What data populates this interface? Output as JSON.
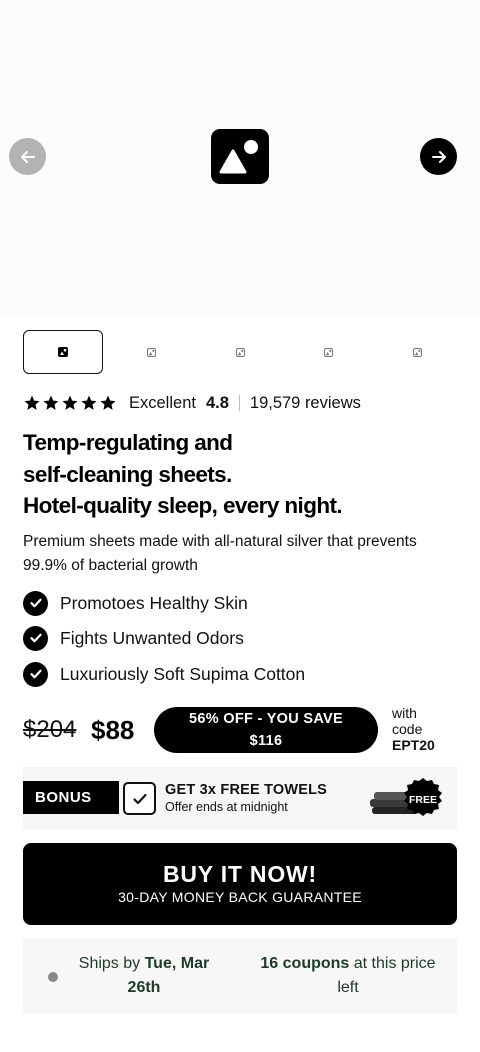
{
  "gallery": {
    "prev_icon": "arrow-left-icon",
    "next_icon": "arrow-right-icon",
    "main_image_icon": "image-placeholder-icon",
    "thumbnail_count": 5,
    "active_thumbnail": 1
  },
  "rating": {
    "stars": 5,
    "label": "Excellent",
    "score": "4.8",
    "reviews": "19,579 reviews"
  },
  "headline": {
    "line1": "Temp-regulating and",
    "line2": "self-cleaning sheets.",
    "line3": "Hotel-quality sleep, every night."
  },
  "subtext": "Premium sheets made with all-natural silver that prevents 99.9% of bacterial growth",
  "benefits": [
    "Promotoes Healthy Skin",
    "Fights Unwanted Odors",
    "Luxuriously Soft Supima Cotton"
  ],
  "pricing": {
    "old_price": "$204",
    "new_price": "$88",
    "save_line1": "56% OFF - YOU SAVE",
    "save_line2": "$116",
    "code_line1": "with",
    "code_line2": "code",
    "code": "EPT20"
  },
  "bonus": {
    "tag": "BONUS",
    "title": "GET 3x FREE TOWELS",
    "subtitle": "Offer ends at midnight",
    "free_badge": "FREE"
  },
  "buy": {
    "title": "BUY IT NOW!",
    "subtitle": "30-DAY MONEY BACK GUARANTEE"
  },
  "shipping": {
    "prefix": "Ships by ",
    "date": "Tue, Mar 26th",
    "coupons_count": "16 coupons",
    "coupons_suffix": " at this price left"
  },
  "colors": {
    "primary": "#000000",
    "nav_disabled": "#b3b3b3",
    "shipping_text": "#1d3a2b"
  }
}
